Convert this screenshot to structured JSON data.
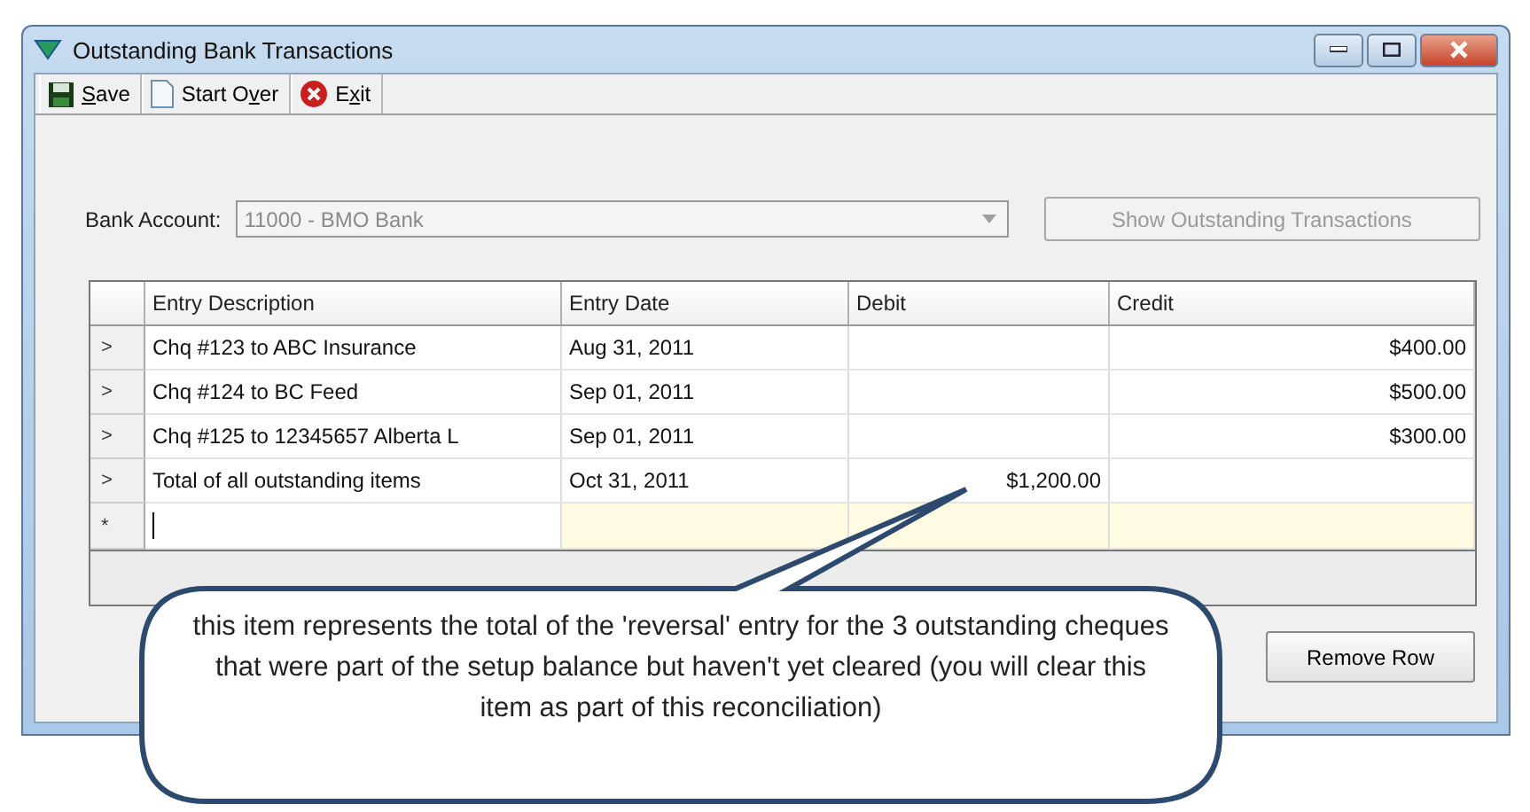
{
  "window": {
    "title": "Outstanding Bank Transactions"
  },
  "toolbar": [
    {
      "kind": "save",
      "key": "S",
      "after": "ave"
    },
    {
      "kind": "new",
      "before": "Start O",
      "key": "v",
      "after": "er"
    },
    {
      "kind": "exit",
      "before": "E",
      "key": "x",
      "after": "it"
    }
  ],
  "bank_account": {
    "label": "Bank Account:",
    "value": "11000 - BMO Bank",
    "disabled": true
  },
  "show_button": {
    "label": "Show Outstanding Transactions",
    "disabled": true
  },
  "grid": {
    "columns": [
      "Entry Description",
      "Entry Date",
      "Debit",
      "Credit"
    ],
    "rows": [
      {
        "marker": ">",
        "cells": [
          "Chq #123 to ABC Insurance",
          "Aug 31, 2011",
          "",
          "$400.00"
        ]
      },
      {
        "marker": ">",
        "cells": [
          "Chq #124 to BC Feed",
          "Sep 01, 2011",
          "",
          "$500.00"
        ]
      },
      {
        "marker": ">",
        "cells": [
          "Chq #125 to 12345657 Alberta L",
          "Sep 01, 2011",
          "",
          "$300.00"
        ]
      },
      {
        "marker": ">",
        "cells": [
          "Total of all outstanding items",
          "Oct 31, 2011",
          "$1,200.00",
          ""
        ]
      }
    ],
    "new_row": {
      "marker": "*"
    }
  },
  "remove_button": {
    "label": "Remove Row"
  },
  "callout": {
    "text": "this item represents the total of the 'reversal' entry for the 3 outstanding cheques that were part of the setup balance but haven't yet cleared (you will clear this item as part of this reconciliation)"
  }
}
